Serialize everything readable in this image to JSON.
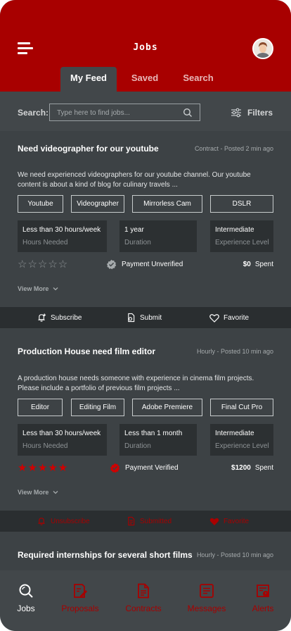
{
  "header": {
    "title": "Jobs"
  },
  "tabs": [
    {
      "label": "My Feed"
    },
    {
      "label": "Saved"
    },
    {
      "label": "Search"
    }
  ],
  "search": {
    "label": "Search:",
    "placeholder": "Type here to find jobs...",
    "filters_label": "Filters"
  },
  "jobs": [
    {
      "title": "Need videographer for our youtube",
      "meta": "Contract - Posted 2 min ago",
      "description": "We need experienced videographers for our youtube channel. Our youtube content is about a kind of blog for culinary travels ...",
      "tags": [
        "Youtube",
        "Videographer",
        "Mirrorless Cam",
        "DSLR"
      ],
      "info": [
        {
          "value": "Less than 30 hours/week",
          "label": "Hours Needed"
        },
        {
          "value": "1 year",
          "label": "Duration"
        },
        {
          "value": "Intermediate",
          "label": "Experience Level"
        }
      ],
      "rating": 0,
      "payment_status": "Payment Unverified",
      "spent_amount": "$0",
      "spent_label": "Spent",
      "view_more": "View More"
    },
    {
      "title": "Production House need film editor",
      "meta": "Hourly - Posted 10 min ago",
      "description": "A production house needs someone with experience in cinema film projects. Please include a portfolio of previous film projects ...",
      "tags": [
        "Editor",
        "Editing Film",
        "Adobe Premiere",
        "Final Cut Pro"
      ],
      "info": [
        {
          "value": "Less than 30 hours/week",
          "label": "Hours Needed"
        },
        {
          "value": "Less than 1 month",
          "label": "Duration"
        },
        {
          "value": "Intermediate",
          "label": "Experience Level"
        }
      ],
      "rating": 5,
      "payment_status": "Payment Verified",
      "spent_amount": "$1200",
      "spent_label": "Spent",
      "view_more": "View More"
    },
    {
      "title": "Required internships for several short films",
      "meta": "Hourly - Posted 10 min ago"
    }
  ],
  "actions": [
    {
      "subscribe": "Subscribe",
      "submit": "Submit",
      "favorite": "Favorite"
    },
    {
      "subscribe": "Unsubscribe",
      "submit": "Submitted",
      "favorite": "Favorite"
    }
  ],
  "bottom_nav": [
    {
      "label": "Jobs",
      "icon": "search-icon"
    },
    {
      "label": "Proposals",
      "icon": "proposal-icon"
    },
    {
      "label": "Contracts",
      "icon": "contract-icon"
    },
    {
      "label": "Messages",
      "icon": "message-icon"
    },
    {
      "label": "Alerts",
      "icon": "alert-icon"
    }
  ],
  "colors": {
    "brand": "#a80000",
    "background": "#42474a",
    "card": "#3d4245"
  }
}
